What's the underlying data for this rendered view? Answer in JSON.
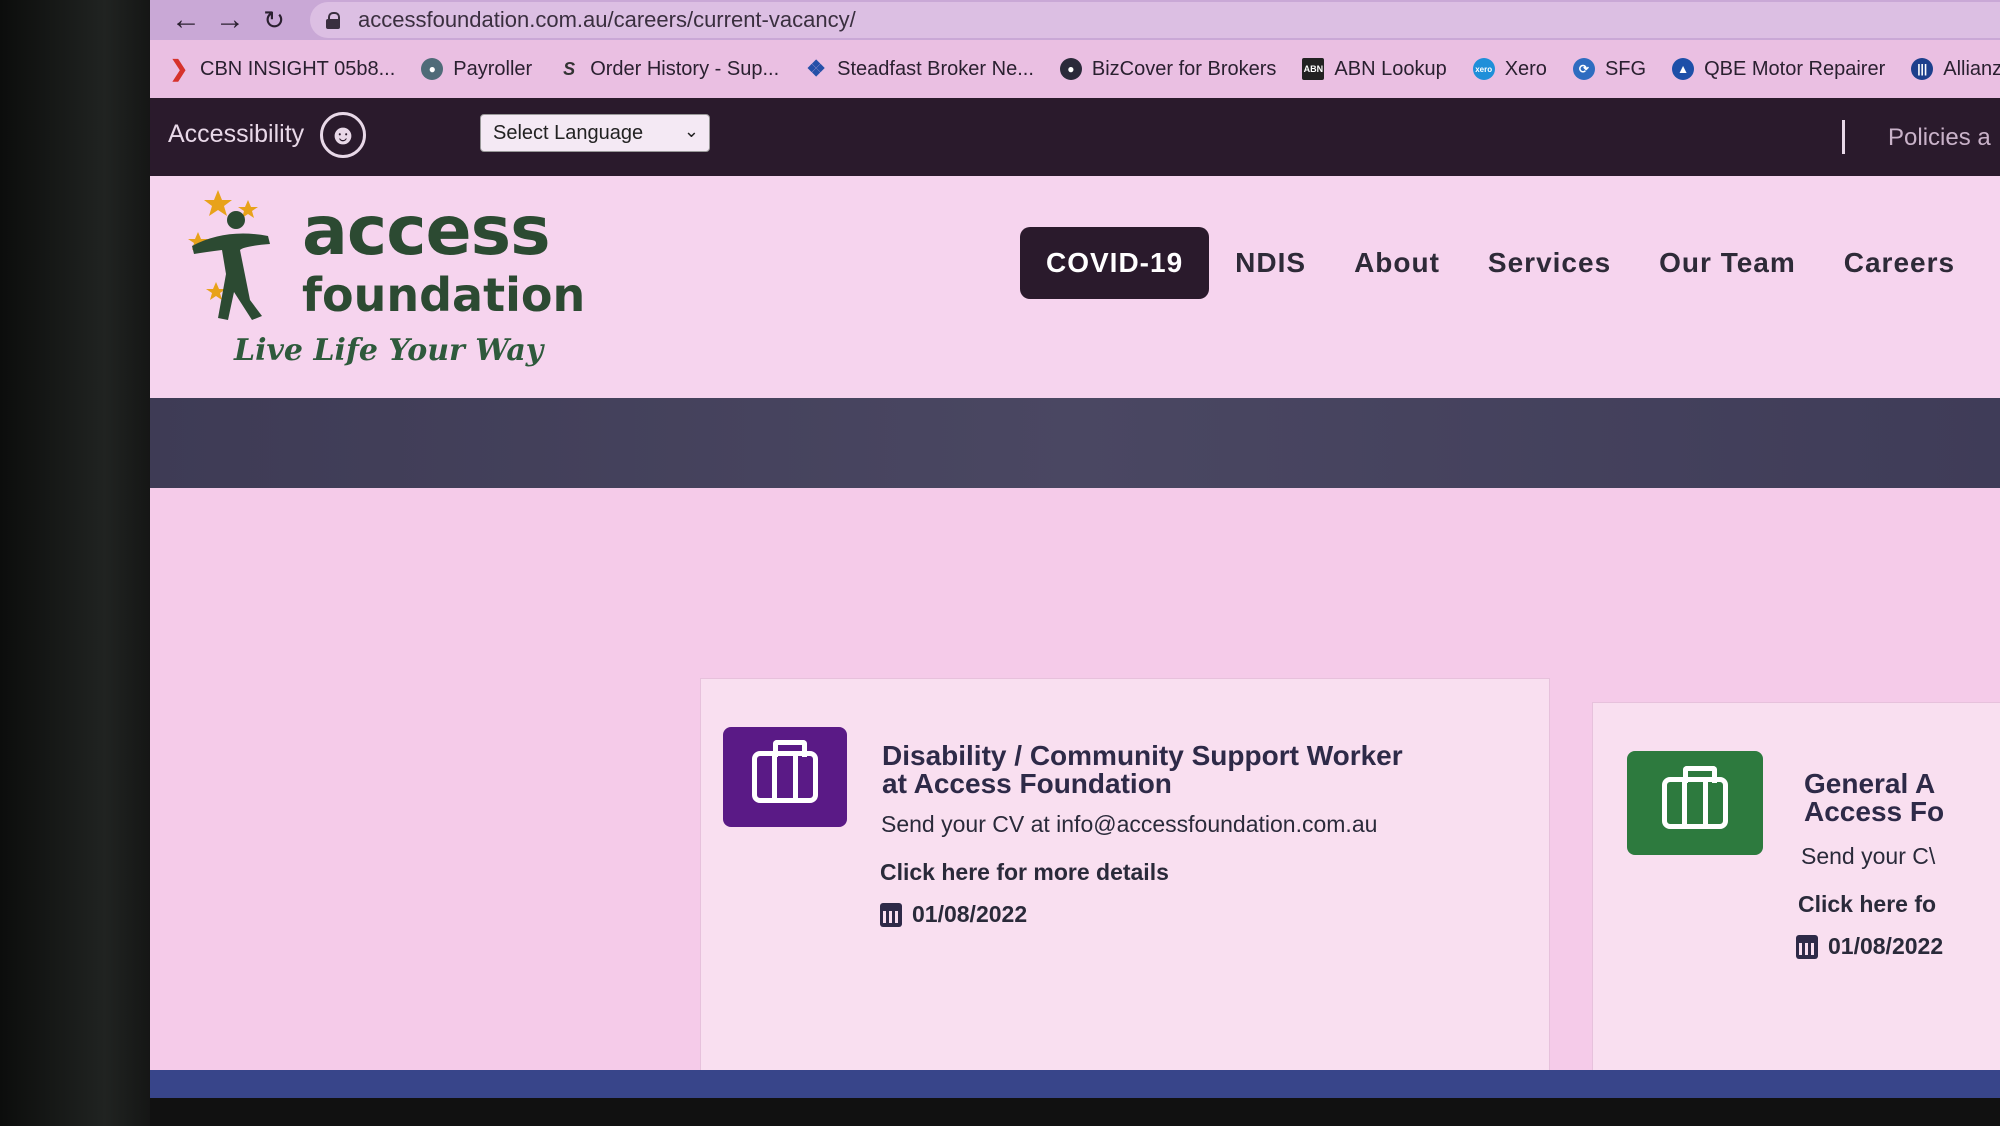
{
  "browser": {
    "url": "accessfoundation.com.au/careers/current-vacancy/",
    "bookmarks": [
      {
        "label": "CBN INSIGHT 05b8...",
        "icon": "chevron-red-icon",
        "color": "#d6322b"
      },
      {
        "label": "Payroller",
        "icon": "payroller-icon",
        "color": "#4f6b78"
      },
      {
        "label": "Order History - Sup...",
        "icon": "s-logo-icon",
        "color": "#333333"
      },
      {
        "label": "Steadfast Broker Ne...",
        "icon": "steadfast-icon",
        "color": "#2550a8"
      },
      {
        "label": "BizCover for Brokers",
        "icon": "bizcover-icon",
        "color": "#2a2a3a"
      },
      {
        "label": "ABN Lookup",
        "icon": "abn-icon",
        "color": "#222222"
      },
      {
        "label": "Xero",
        "icon": "xero-icon",
        "color": "#1f8fd9"
      },
      {
        "label": "SFG",
        "icon": "sfg-icon",
        "color": "#2e6cc0"
      },
      {
        "label": "QBE Motor Repairer",
        "icon": "qbe-icon",
        "color": "#1d4fa8"
      },
      {
        "label": "Allianz Home E",
        "icon": "allianz-icon",
        "color": "#1c3f8c"
      }
    ]
  },
  "topbar": {
    "accessibility_label": "Accessibility",
    "language_select": "Select Language",
    "policies_label": "Policies a"
  },
  "logo": {
    "word1": "access",
    "word2": "foundation",
    "tagline": "Live Life Your Way"
  },
  "nav": {
    "items": [
      {
        "label": "COVID-19",
        "active": true
      },
      {
        "label": "NDIS"
      },
      {
        "label": "About"
      },
      {
        "label": "Services"
      },
      {
        "label": "Our Team"
      },
      {
        "label": "Careers"
      }
    ]
  },
  "jobs": [
    {
      "title_line1": "Disability / Community Support Worker",
      "title_line2": "at Access Foundation",
      "cv": "Send your CV at info@accessfoundation.com.au",
      "link": "Click here for more details",
      "date": "01/08/2022",
      "color": "#5a1a86"
    },
    {
      "title_line1": "General A",
      "title_line2": "Access Fo",
      "cv": "Send your C\\",
      "link": "Click here fo",
      "date": "01/08/2022",
      "color": "#2d7a3e"
    }
  ],
  "colors": {
    "topbar": "#2a1a2c",
    "header": "#f6d4ee",
    "logo_green": "#2c4a32"
  }
}
